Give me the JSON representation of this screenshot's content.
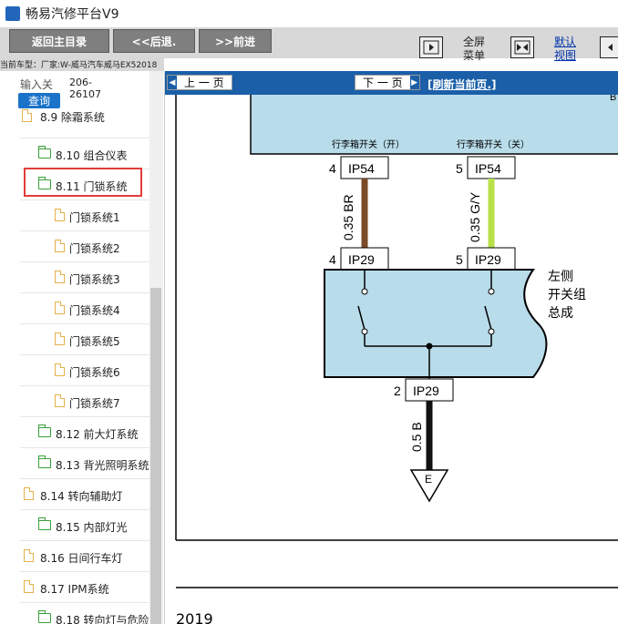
{
  "window": {
    "title": "畅易汽修平台V9"
  },
  "toolbar": {
    "home_label": "返回主目录",
    "back_label": "<<后退.",
    "forward_label": ">>前进",
    "fullscreen_label_1": "全屏",
    "fullscreen_label_2": "菜单",
    "default_view_label_1": "默认",
    "default_view_label_2": "视图"
  },
  "vehicle": {
    "text": "当前车型：厂家:W-威马汽车威马EX52018"
  },
  "search": {
    "label": "输入关",
    "button": "查询",
    "value_1": "206-",
    "value_2": "26107"
  },
  "tree": {
    "items": [
      {
        "label": "8.9 除霜系统"
      },
      {
        "label": "8.10 组合仪表"
      },
      {
        "label": "8.11 门锁系统"
      },
      {
        "label": "门锁系统1"
      },
      {
        "label": "门锁系统2"
      },
      {
        "label": "门锁系统3"
      },
      {
        "label": "门锁系统4"
      },
      {
        "label": "门锁系统5"
      },
      {
        "label": "门锁系统6"
      },
      {
        "label": "门锁系统7"
      },
      {
        "label": "8.12 前大灯系统"
      },
      {
        "label": "8.13 背光照明系统"
      },
      {
        "label": "8.14 转向辅助灯"
      },
      {
        "label": "8.15 内部灯光"
      },
      {
        "label": "8.16 日间行车灯"
      },
      {
        "label": "8.17 IPM系统"
      },
      {
        "label": "8.18 转向灯与危险"
      }
    ]
  },
  "nav": {
    "prev": "上 一 页",
    "next": "下 一 页",
    "refresh": "[刷新当前页.]"
  },
  "diagram": {
    "corner_label": "B",
    "switch_open_label": "行李箱开关（开）",
    "switch_closed_label": "行李箱开关（关）",
    "pin_4": "4",
    "pin_5": "5",
    "pin_2": "2",
    "conn_ip54": "IP54",
    "conn_ip29": "IP29",
    "wire_br": "0.35 BR",
    "wire_gy": "0.35 G/Y",
    "wire_b": "0.5 B",
    "component_line1": "左侧",
    "component_line2": "开关组",
    "component_line3": "总成",
    "ground": "E",
    "year": "2019"
  },
  "colors": {
    "wire_br": "#7a4a2a",
    "wire_gy": "#b8e04a",
    "box_fill": "#b8dcea",
    "nav_bg": "#1a5fa8"
  }
}
